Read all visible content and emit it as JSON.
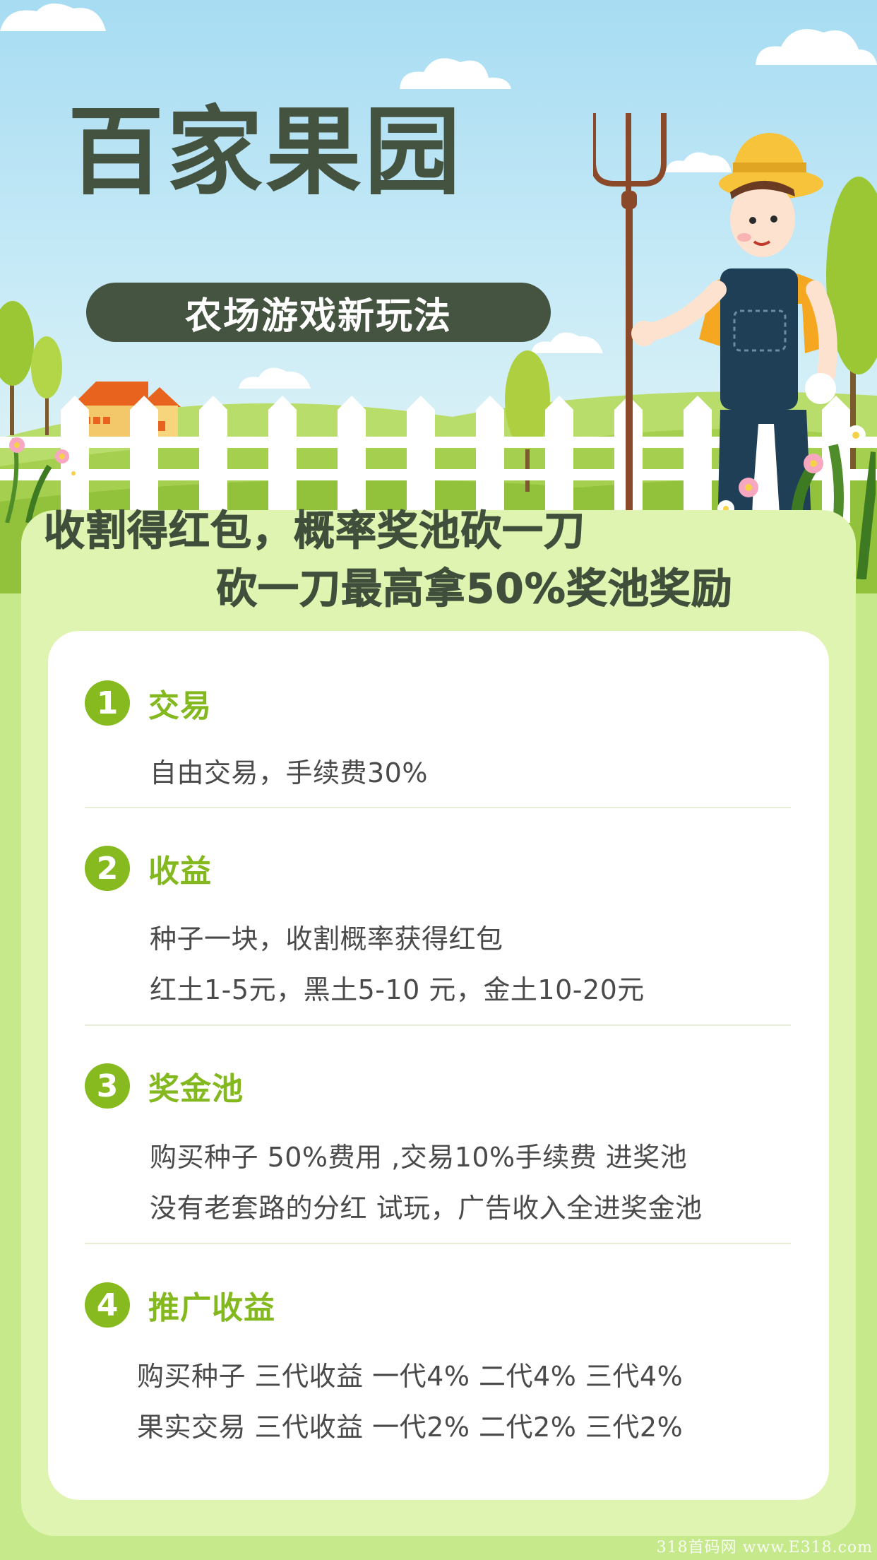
{
  "header": {
    "title": "百家果园",
    "subtitle": "农场游戏新玩法"
  },
  "slogan": {
    "line1": "收割得红包，概率奖池砍一刀",
    "line2": "砍一刀最高拿50%奖池奖励"
  },
  "sections": [
    {
      "number": "1",
      "title": "交易",
      "lines": [
        "自由交易，手续费30%"
      ]
    },
    {
      "number": "2",
      "title": "收益",
      "lines": [
        "种子一块，收割概率获得红包",
        "红土1-5元，黑土5-10 元，金土10-20元"
      ]
    },
    {
      "number": "3",
      "title": "奖金池",
      "lines": [
        "购买种子 50%费用 ,交易10%手续费 进奖池",
        "没有老套路的分红 试玩，广告收入全进奖金池"
      ]
    },
    {
      "number": "4",
      "title": "推广收益",
      "lines": [
        "购买种子 三代收益 一代4% 二代4% 三代4%",
        "果实交易 三代收益 一代2% 二代2% 三代2%"
      ]
    }
  ],
  "watermark": "318首码网 www.E318.com",
  "colors": {
    "title": "#435340",
    "pill": "#455441",
    "accent_green": "#86ba1f",
    "panel": "#dff4b0",
    "background": "#c6e98c"
  },
  "icons": [
    "cloud-icon",
    "house-icon",
    "tree-icon",
    "fence-icon",
    "farmer-illustration",
    "flower-icon"
  ]
}
